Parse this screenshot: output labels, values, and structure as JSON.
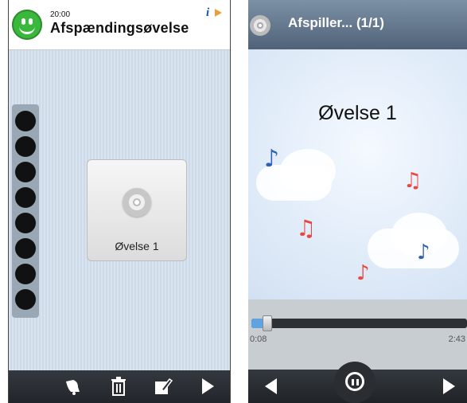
{
  "left_screen": {
    "header": {
      "time": "20:00",
      "title": "Afspændingsøvelse"
    },
    "indicator_dots": 8,
    "media_tile": {
      "label": "Øvelse 1",
      "icon": "cd-icon"
    },
    "toolbar": {
      "icons": [
        "bell-icon",
        "trash-icon",
        "edit-icon",
        "play-icon"
      ]
    }
  },
  "right_screen": {
    "header": {
      "title": "Afspiller... (1/1)"
    },
    "song_title": "Øvelse 1",
    "progress": {
      "current": "0:08",
      "total": "2:43",
      "fraction": 0.05
    },
    "controls": {
      "icons": [
        "previous-icon",
        "pause-icon",
        "next-icon"
      ]
    }
  }
}
